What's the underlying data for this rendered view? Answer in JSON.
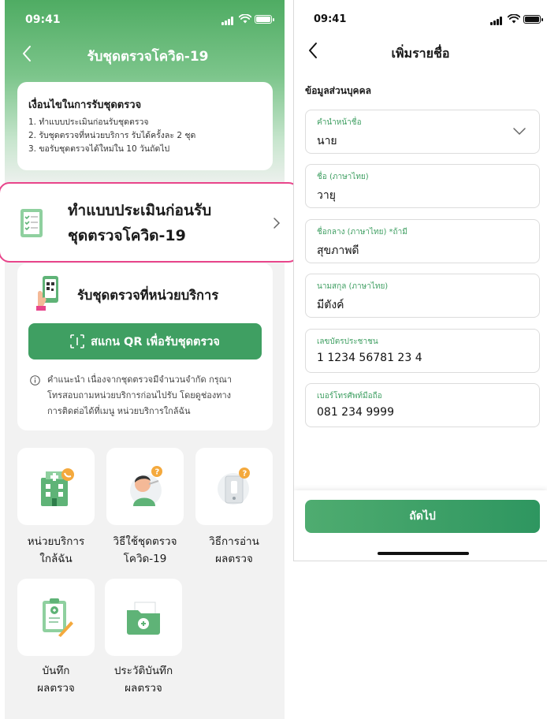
{
  "left_screen": {
    "status_time": "09:41",
    "title": "รับชุดตรวจโควิด-19",
    "conditions": {
      "title": "เงื่อนไขในการรับชุดตรวจ",
      "items": [
        "1. ทำแบบประเมินก่อนรับชุดตรวจ",
        "2. รับชุดตรวจที่หน่วยบริการ รับได้ครั้งละ 2 ชุด",
        "3. ขอรับชุดตรวจได้ใหม่ใน 10 วันถัดไป"
      ]
    },
    "assessment": {
      "line1": "ทำแบบประเมินก่อนรับ",
      "line2": "ชุดตรวจโควิด-19"
    },
    "service": {
      "title": "รับชุดตรวจที่หน่วยบริการ",
      "scan_button": "สแกน QR เพื่อรับชุดตรวจ",
      "advice_lines": [
        "คำแนะนำ เนื่องจากชุดตรวจมีจำนวนจำกัด กรุณา",
        "โทรสอบถามหน่วยบริการก่อนไปรับ โดยดูช่องทาง",
        "การติดต่อได้ที่เมนู หน่วยบริการใกล้ฉัน"
      ]
    },
    "menu": [
      {
        "line1": "หน่วยบริการ",
        "line2": "ใกล้ฉัน",
        "icon": "hospital-icon"
      },
      {
        "line1": "วิธีใช้ชุดตรวจ",
        "line2": "โควิด-19",
        "icon": "swab-test-icon"
      },
      {
        "line1": "วิธีการอ่าน",
        "line2": "ผลตรวจ",
        "icon": "test-kit-icon"
      },
      {
        "line1": "บันทึก",
        "line2": "ผลตรวจ",
        "icon": "clipboard-record-icon"
      },
      {
        "line1": "ประวัติบันทึก",
        "line2": "ผลตรวจ",
        "icon": "history-folder-icon"
      }
    ]
  },
  "right_screen": {
    "status_time": "09:41",
    "title": "เพิ่มรายชื่อ",
    "section_title": "ข้อมูลส่วนบุคคล",
    "fields": [
      {
        "label": "คำนำหน้าชื่อ",
        "value": "นาย",
        "type": "select"
      },
      {
        "label": "ชื่อ (ภาษาไทย)",
        "value": "วายุ",
        "type": "text"
      },
      {
        "label": "ชื่อกลาง (ภาษาไทย) *ถ้ามี",
        "value": "สุขภาพดี",
        "type": "text"
      },
      {
        "label": "นามสกุล (ภาษาไทย)",
        "value": "มีตังค์",
        "type": "text"
      },
      {
        "label": "เลขบัตรประชาชน",
        "value": "1 1234 56781 23 4",
        "type": "text"
      },
      {
        "label": "เบอร์โทรศัพท์มือถือ",
        "value": "081 234 9999",
        "type": "text"
      }
    ],
    "next_button": "ถัดไป"
  },
  "colors": {
    "primary_green": "#3f9f62",
    "highlight_pink": "#e8458b",
    "header_green": "#4fac63"
  }
}
